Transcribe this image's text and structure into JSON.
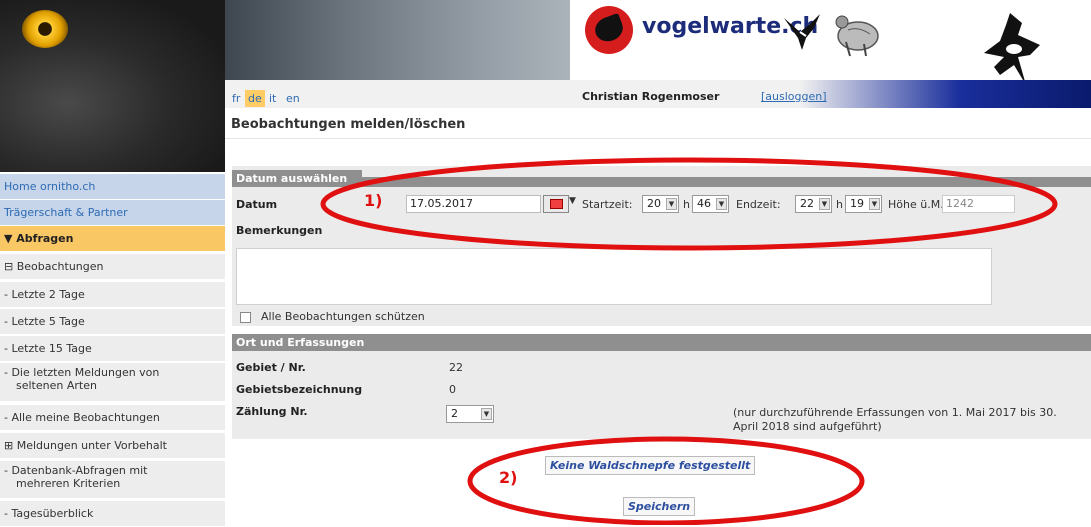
{
  "header": {
    "site_name": "vogelwarte.ch",
    "languages": [
      "fr",
      "de",
      "it",
      "en"
    ],
    "active_language": "de",
    "user_name": "Christian Rogenmoser",
    "logout_label": "[ausloggen]",
    "page_title": "Beobachtungen melden/löschen"
  },
  "sidebar": {
    "items": [
      {
        "label": "Home ornitho.ch"
      },
      {
        "label": "Trägerschaft & Partner"
      },
      {
        "label": "▼ Abfragen"
      },
      {
        "label": "⊟ Beobachtungen"
      },
      {
        "label": "- Letzte 2 Tage"
      },
      {
        "label": "- Letzte 5 Tage"
      },
      {
        "label": "- Letzte 15 Tage"
      },
      {
        "label": "- Die letzten Meldungen von",
        "label2": "seltenen Arten"
      },
      {
        "label": "- Alle meine Beobachtungen"
      },
      {
        "label": "⊞ Meldungen unter Vorbehalt"
      },
      {
        "label": "- Datenbank-Abfragen mit",
        "label2": "mehreren Kriterien"
      },
      {
        "label": "- Tagesüberblick"
      }
    ]
  },
  "datum_section": {
    "heading": "Datum auswählen",
    "datum_label": "Datum",
    "datum_value": "17.05.2017",
    "start_label": "Startzeit:",
    "start_hour": "20",
    "start_min": "46",
    "end_label": "Endzeit:",
    "end_hour": "22",
    "end_min": "19",
    "h_label": "h",
    "hoehe_label": "Höhe ü.M.",
    "hoehe_value": "1242",
    "bemerkungen_label": "Bemerkungen",
    "protect_label": "Alle Beobachtungen schützen"
  },
  "ort_section": {
    "heading": "Ort und Erfassungen",
    "gebiet_label": "Gebiet / Nr.",
    "gebiet_value": "22",
    "bezeichnung_label": "Gebietsbezeichnung",
    "bezeichnung_value": "0",
    "zaehlung_label": "Zählung Nr.",
    "zaehlung_value": "2",
    "note_line1": "(nur durchzuführende Erfassungen von 1. Mai 2017 bis 30.",
    "note_line2": "April 2018 sind aufgeführt)"
  },
  "actions": {
    "no_woodcock_label": "Keine Waldschnepfe festgestellt",
    "save_label": "Speichern"
  },
  "annotations": {
    "marker1": "1)",
    "marker2": "2)",
    "color": "#e01010"
  },
  "colors": {
    "sidebar_blue": "#c7d5ea",
    "sidebar_active": "#f9c763",
    "section_header": "#8f8f8f",
    "link": "#2d6bb3"
  }
}
